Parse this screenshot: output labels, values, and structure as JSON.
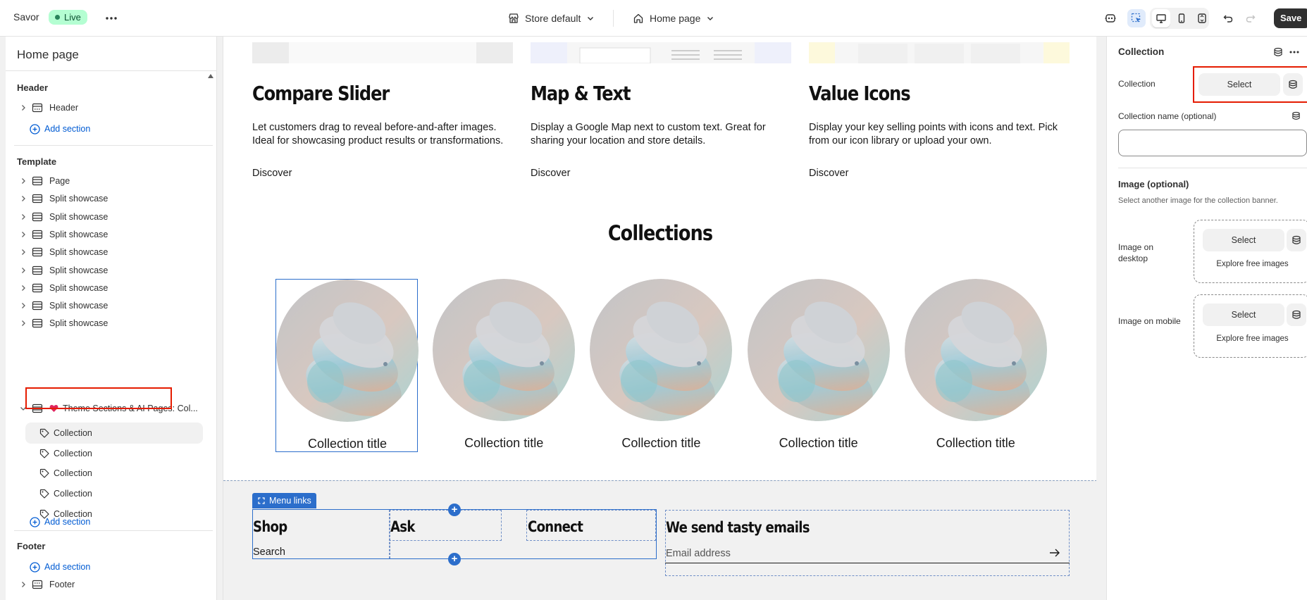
{
  "topbar": {
    "store_name": "Savor",
    "status_badge": "Live",
    "theme_selector": "Store default",
    "page_selector": "Home page",
    "save_label": "Save"
  },
  "sidebar": {
    "title": "Home page",
    "header_group": {
      "title": "Header",
      "items": [
        "Header"
      ],
      "add_label": "Add section"
    },
    "template_group": {
      "title": "Template",
      "items": [
        "Page",
        "Split showcase",
        "Split showcase",
        "Split showcase",
        "Split showcase",
        "Split showcase",
        "Split showcase",
        "Split showcase",
        "Split showcase"
      ],
      "expanded_item": "Theme Sections & AI Pages: Col...",
      "expanded_children": [
        "Collection",
        "Collection",
        "Collection",
        "Collection",
        "Collection"
      ],
      "add_label": "Add section"
    },
    "footer_group": {
      "title": "Footer",
      "add_label": "Add section",
      "items": [
        "Footer"
      ]
    }
  },
  "preview": {
    "features": [
      {
        "title": "Compare Slider",
        "desc": "Let customers drag to reveal before-and-after images. Ideal for showcasing product results or transformations.",
        "link": "Discover"
      },
      {
        "title": "Map & Text",
        "desc": "Display a Google Map next to custom text. Great for sharing your location and store details.",
        "link": "Discover"
      },
      {
        "title": "Value Icons",
        "desc": "Display your key selling points with icons and text. Pick from our icon library or upload your own.",
        "link": "Discover"
      }
    ],
    "collections_heading": "Collections",
    "collection_cards": [
      "Collection title",
      "Collection title",
      "Collection title",
      "Collection title",
      "Collection title"
    ],
    "menu_links_tag": "Menu links",
    "menu_columns": [
      {
        "heading": "Shop",
        "links": [
          "Search"
        ]
      },
      {
        "heading": "Ask",
        "links": []
      },
      {
        "heading": "Connect",
        "links": []
      }
    ],
    "newsletter": {
      "title": "We send tasty emails",
      "placeholder": "Email address"
    }
  },
  "settings_panel": {
    "title": "Collection",
    "collection_label": "Collection",
    "collection_select": "Select",
    "collection_name_label": "Collection name (optional)",
    "image_heading": "Image (optional)",
    "image_help": "Select another image for the collection banner.",
    "desktop_label": "Image on desktop",
    "mobile_label": "Image on mobile",
    "select_label": "Select",
    "explore_label": "Explore free images"
  },
  "colors": {
    "accent": "#2c6ecb",
    "highlight": "#e51c00",
    "live_badge": "#b4fed2"
  }
}
